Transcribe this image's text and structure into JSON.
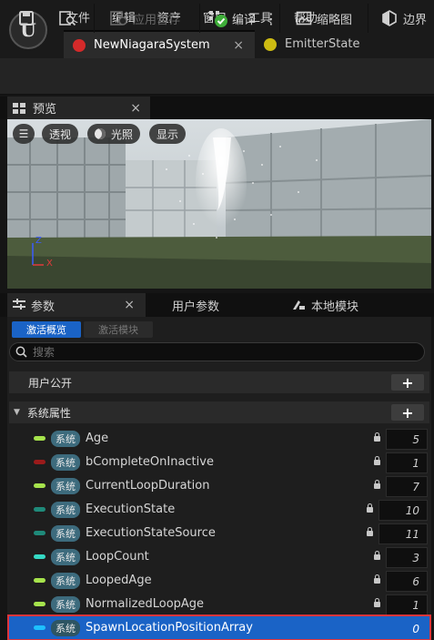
{
  "app": {
    "logo_text": "U"
  },
  "menu": [
    {
      "label": "文件"
    },
    {
      "label": "编辑"
    },
    {
      "label": "资产"
    },
    {
      "label": "窗口"
    },
    {
      "label": "工具"
    },
    {
      "label": "帮助"
    }
  ],
  "tabs": [
    {
      "label": "NewNiagaraSystem",
      "active": true,
      "icon_color": "#d42a2a",
      "close": "×"
    },
    {
      "label": "EmitterState",
      "active": false,
      "icon_color": "#cdbb12"
    }
  ],
  "toolbar": {
    "apply_pending_label": "应用暂存",
    "compile_label": "编译",
    "more_label": "⋮",
    "thumbnail_label": "缩略图",
    "bounds_label": "边界"
  },
  "preview": {
    "tab_label": "预览",
    "close": "×",
    "hamburger": "☰",
    "perspective_label": "透视",
    "lighting_label": "光照",
    "show_label": "显示",
    "axis_z": "Z",
    "axis_x": "X"
  },
  "params": {
    "tab_label": "参数",
    "close": "×",
    "user_params_label": "用户参数",
    "local_modules_label": "本地模块",
    "active_overview_label": "激活概览",
    "active_modules_label": "激活模块",
    "search_placeholder": "搜索",
    "user_exposed_label": "用户公开",
    "system_attributes_label": "系统属性",
    "plus": "+",
    "namespace_badge": "系统",
    "rows": [
      {
        "name": "Age",
        "value": "5",
        "pin_color": "#a6e34c"
      },
      {
        "name": "bCompleteOnInactive",
        "value": "1",
        "pin_color": "#9b1b1b"
      },
      {
        "name": "CurrentLoopDuration",
        "value": "7",
        "pin_color": "#a6e34c"
      },
      {
        "name": "ExecutionState",
        "value": "10",
        "pin_color": "#1f8a7a"
      },
      {
        "name": "ExecutionStateSource",
        "value": "11",
        "pin_color": "#1f8a7a"
      },
      {
        "name": "LoopCount",
        "value": "3",
        "pin_color": "#35d9c4"
      },
      {
        "name": "LoopedAge",
        "value": "6",
        "pin_color": "#a6e34c"
      },
      {
        "name": "NormalizedLoopAge",
        "value": "1",
        "pin_color": "#a6e34c"
      },
      {
        "name": "SpawnLocationPositionArray",
        "value": "0",
        "pin_color": "#1ec0ff",
        "selected": true
      }
    ]
  }
}
